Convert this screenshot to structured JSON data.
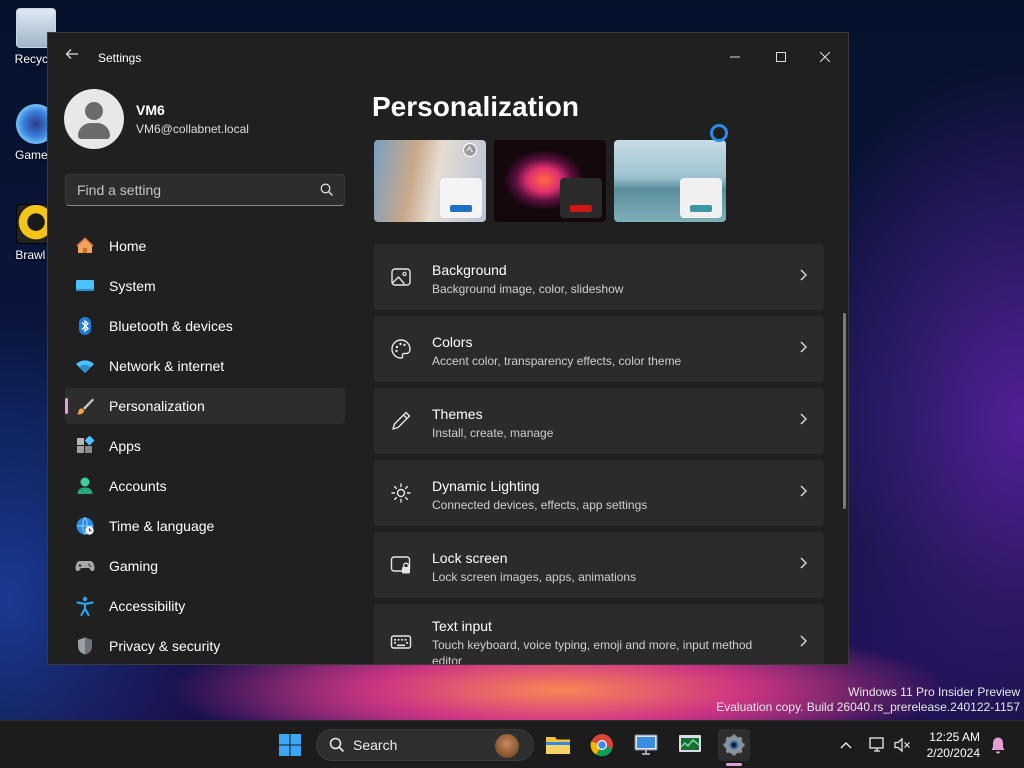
{
  "desktop": {
    "icons": [
      {
        "label": "Recycle"
      },
      {
        "label": "Gamelo"
      },
      {
        "label": "Brawl S"
      }
    ],
    "watermark": {
      "line1": "Windows 11 Pro Insider Preview",
      "line2": "Evaluation copy. Build 26040.rs_prerelease.240122-1157"
    }
  },
  "window": {
    "title": "Settings",
    "controls": {
      "minimize": "minimize-icon",
      "maximize": "maximize-icon",
      "close": "close-icon"
    }
  },
  "profile": {
    "name": "VM6",
    "email": "VM6@collabnet.local"
  },
  "search": {
    "placeholder": "Find a setting"
  },
  "sidebar": {
    "items": [
      {
        "label": "Home",
        "icon": "home-icon"
      },
      {
        "label": "System",
        "icon": "system-icon"
      },
      {
        "label": "Bluetooth & devices",
        "icon": "bluetooth-icon"
      },
      {
        "label": "Network & internet",
        "icon": "network-icon"
      },
      {
        "label": "Personalization",
        "icon": "brush-icon",
        "active": true
      },
      {
        "label": "Apps",
        "icon": "apps-icon"
      },
      {
        "label": "Accounts",
        "icon": "accounts-icon"
      },
      {
        "label": "Time & language",
        "icon": "globe-clock-icon"
      },
      {
        "label": "Gaming",
        "icon": "gamepad-icon"
      },
      {
        "label": "Accessibility",
        "icon": "accessibility-icon"
      },
      {
        "label": "Privacy & security",
        "icon": "shield-icon"
      }
    ]
  },
  "main": {
    "title": "Personalization",
    "themes": [
      {
        "accent": "#1f6fc4",
        "selected": false
      },
      {
        "accent": "#d01515",
        "selected": false
      },
      {
        "accent": "#3d96a3",
        "selected": true
      }
    ],
    "cards": [
      {
        "title": "Background",
        "subtitle": "Background image, color, slideshow",
        "icon": "image-icon"
      },
      {
        "title": "Colors",
        "subtitle": "Accent color, transparency effects, color theme",
        "icon": "palette-icon"
      },
      {
        "title": "Themes",
        "subtitle": "Install, create, manage",
        "icon": "pen-icon"
      },
      {
        "title": "Dynamic Lighting",
        "subtitle": "Connected devices, effects, app settings",
        "icon": "dynamic-lighting-icon"
      },
      {
        "title": "Lock screen",
        "subtitle": "Lock screen images, apps, animations",
        "icon": "lock-screen-icon"
      },
      {
        "title": "Text input",
        "subtitle": "Touch keyboard, voice typing, emoji and more, input method editor",
        "icon": "keyboard-icon"
      }
    ]
  },
  "taskbar": {
    "search_label": "Search",
    "time": "12:25 AM",
    "date": "2/20/2024",
    "colors": {
      "accent": "#e59fd4"
    }
  }
}
